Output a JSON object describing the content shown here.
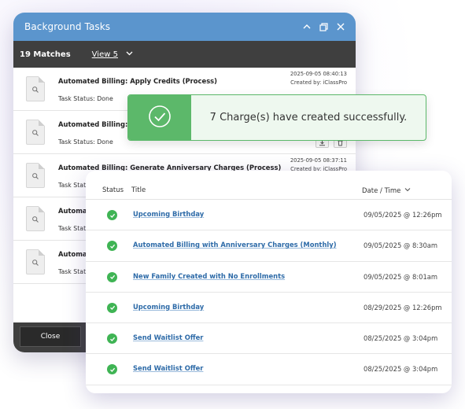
{
  "window": {
    "title": "Background Tasks",
    "matches": "19 Matches",
    "view": "View 5",
    "close_label": "Close"
  },
  "tasks": [
    {
      "name": "Automated Billing: Apply Credits (Process)",
      "status": "Task Status: Done",
      "date": "2025-09-05 08:40:13",
      "created": "Created by: iClassPro"
    },
    {
      "name": "Automated Billing: Ap",
      "status": "Task Status: Done",
      "date": "",
      "created": ""
    },
    {
      "name": "Automated Billing: Generate Anniversary Charges (Process)",
      "status": "Task Statu",
      "date": "2025-09-05 08:37:11",
      "created": "Created by: iClassPro"
    },
    {
      "name": "Automat",
      "status": "Task Statu",
      "date": "",
      "created": ""
    },
    {
      "name": "Automat",
      "status": "Task Statu",
      "date": "",
      "created": ""
    }
  ],
  "toast": {
    "message": "7 Charge(s) have created successfully.",
    "accent": "#5cb86a"
  },
  "notifications": {
    "headers": {
      "status": "Status",
      "title": "Title",
      "date": "Date / Time"
    },
    "rows": [
      {
        "title": "Upcoming Birthday",
        "date": "09/05/2025 @ 12:26pm"
      },
      {
        "title": "Automated Billing with Anniversary Charges (Monthly)",
        "date": "09/05/2025 @ 8:30am"
      },
      {
        "title": "New Family Created with No Enrollments",
        "date": "09/05/2025 @ 8:01am"
      },
      {
        "title": "Upcoming Birthday",
        "date": "08/29/2025 @ 12:26pm"
      },
      {
        "title": "Send Waitlist Offer",
        "date": "08/25/2025 @ 3:04pm"
      },
      {
        "title": "Send Waitlist Offer",
        "date": "08/25/2025 @ 3:04pm"
      }
    ]
  },
  "colors": {
    "titlebar": "#5b95cd",
    "toolbar": "#3f3f3f",
    "success": "#3fb454",
    "link": "#2e6ba8"
  }
}
